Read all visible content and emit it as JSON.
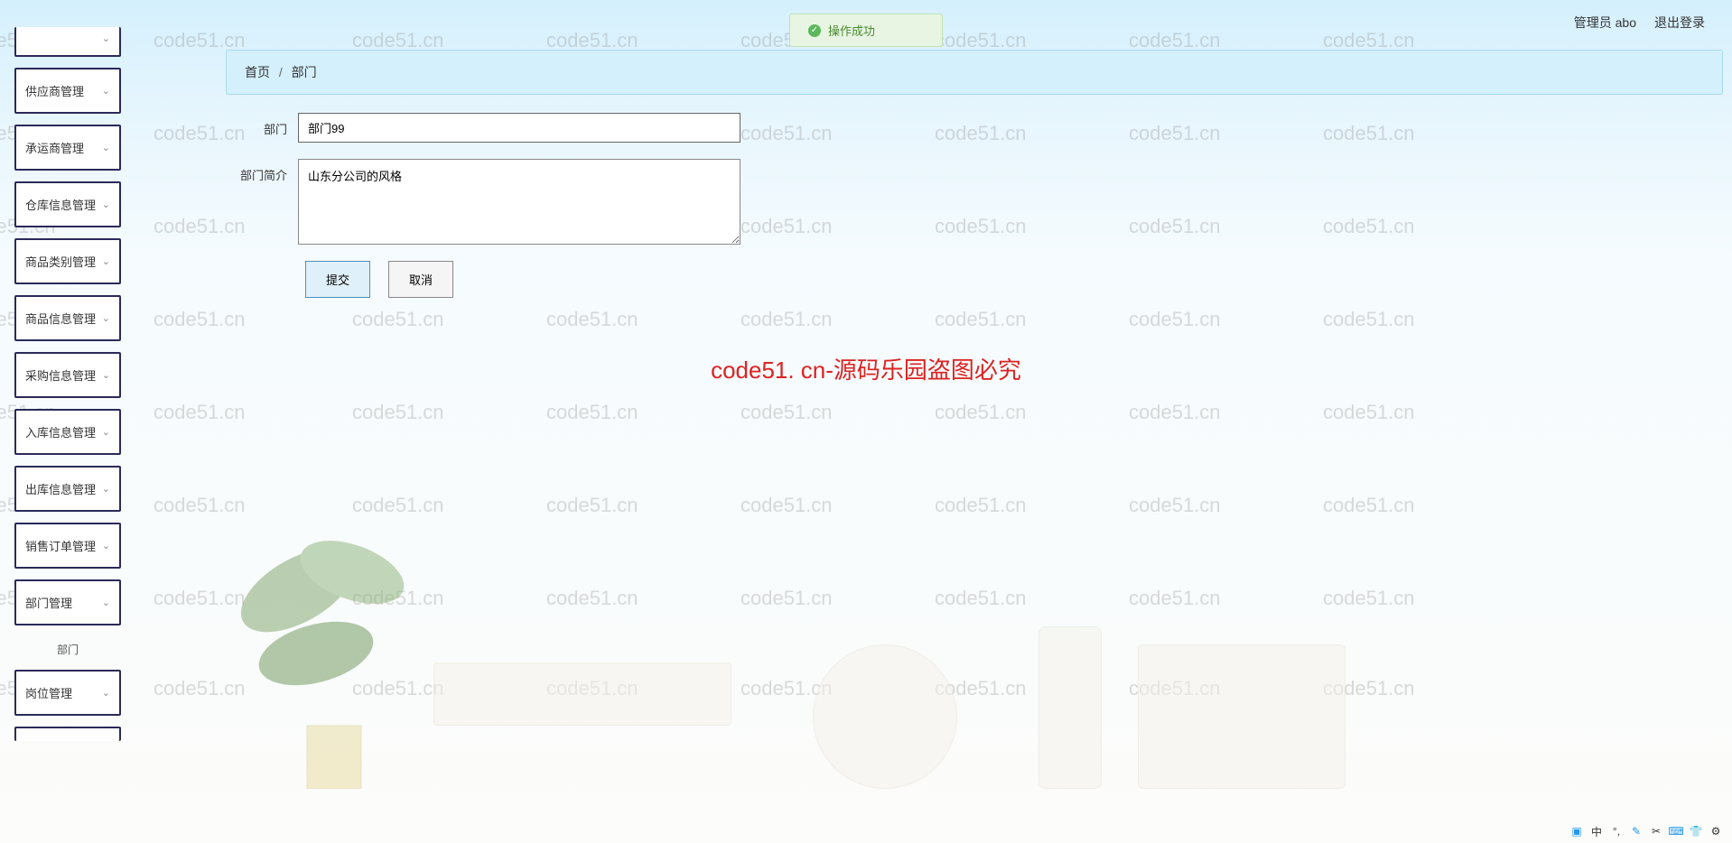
{
  "header": {
    "admin_label": "管理员 abo",
    "logout_label": "退出登录"
  },
  "notification": {
    "success_text": "操作成功"
  },
  "sidebar": {
    "items": [
      {
        "label": "供应商管理"
      },
      {
        "label": "承运商管理"
      },
      {
        "label": "仓库信息管理"
      },
      {
        "label": "商品类别管理"
      },
      {
        "label": "商品信息管理"
      },
      {
        "label": "采购信息管理"
      },
      {
        "label": "入库信息管理"
      },
      {
        "label": "出库信息管理"
      },
      {
        "label": "销售订单管理"
      },
      {
        "label": "部门管理"
      },
      {
        "label": "岗位管理"
      }
    ],
    "sub_item": "部门"
  },
  "breadcrumb": {
    "home": "首页",
    "current": "部门"
  },
  "form": {
    "dept_label": "部门",
    "dept_value": "部门99",
    "desc_label": "部门简介",
    "desc_value": "山东分公司的风格",
    "submit_label": "提交",
    "cancel_label": "取消"
  },
  "watermark": {
    "text": "code51.cn",
    "center_text": "code51. cn-源码乐园盗图必究"
  },
  "tray": {
    "ime": "中"
  }
}
